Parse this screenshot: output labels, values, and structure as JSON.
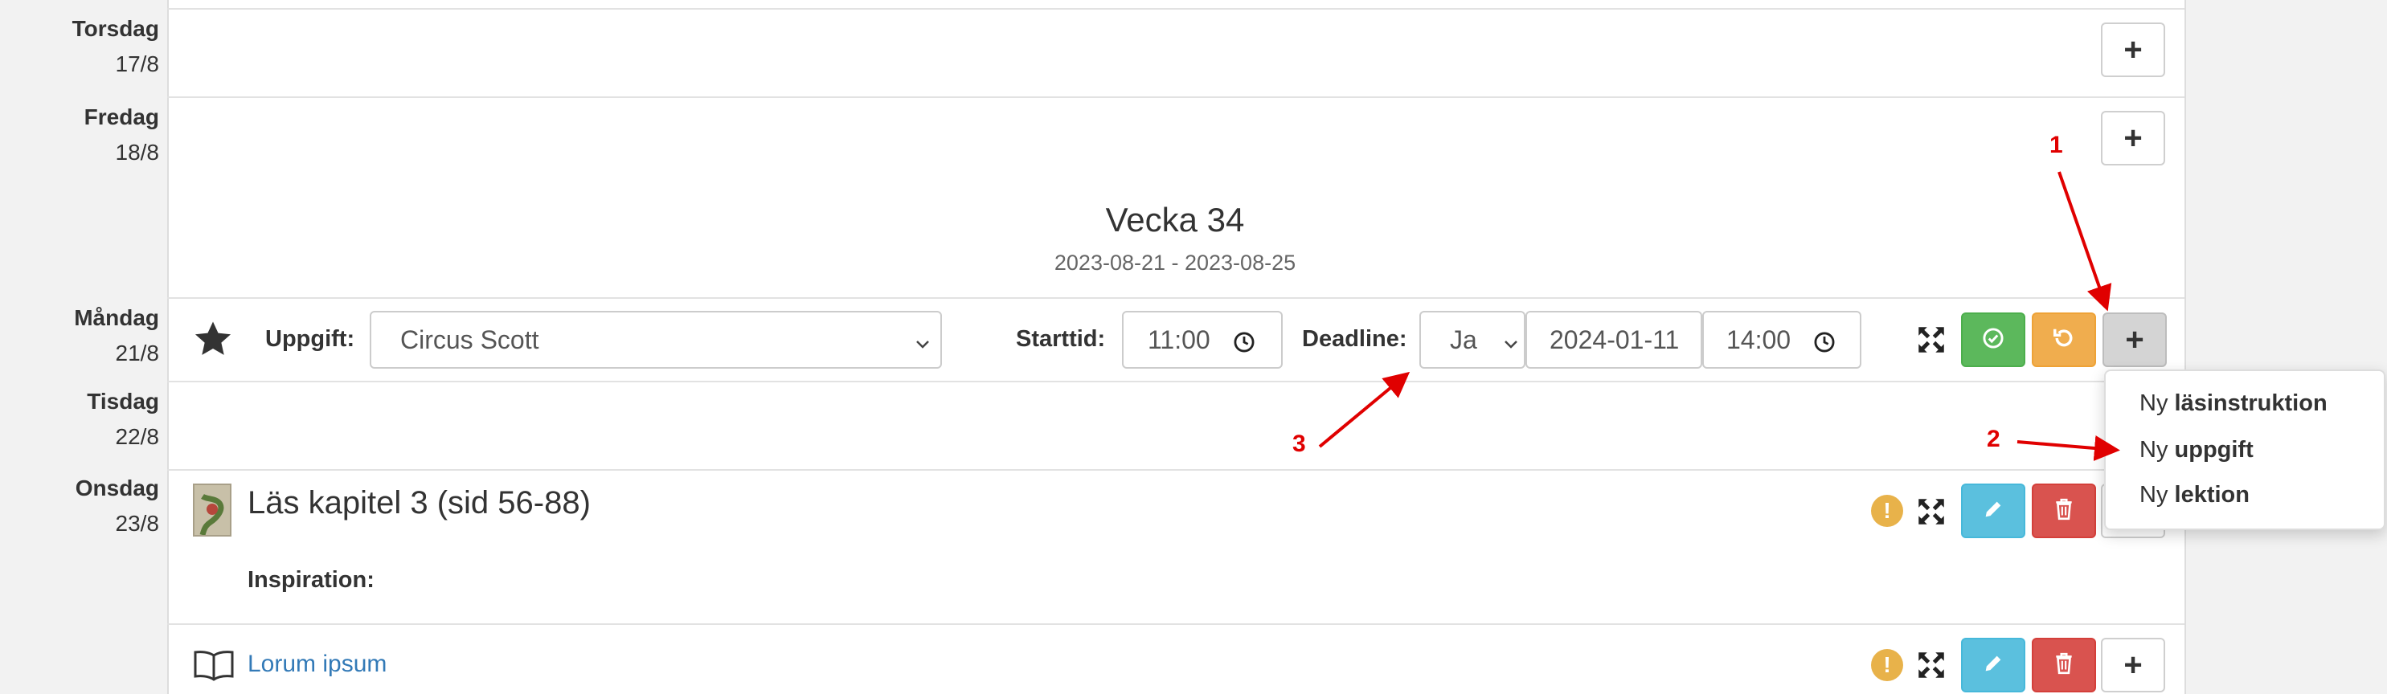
{
  "days": [
    {
      "name": "Torsdag",
      "date": "17/8"
    },
    {
      "name": "Fredag",
      "date": "18/8"
    },
    {
      "name": "Måndag",
      "date": "21/8"
    },
    {
      "name": "Tisdag",
      "date": "22/8"
    },
    {
      "name": "Onsdag",
      "date": "23/8"
    }
  ],
  "week": {
    "title": "Vecka 34",
    "range": "2023-08-21 - 2023-08-25"
  },
  "form": {
    "task_label": "Uppgift:",
    "task_value": "Circus Scott",
    "start_label": "Starttid:",
    "start_time": "11:00",
    "deadline_label": "Deadline:",
    "deadline_choice": "Ja",
    "deadline_date": "2024-01-11",
    "deadline_time": "14:00"
  },
  "menu": {
    "items": [
      {
        "prefix": "Ny",
        "bold": "läsinstruktion"
      },
      {
        "prefix": "Ny",
        "bold": "uppgift"
      },
      {
        "prefix": "Ny",
        "bold": "lektion"
      }
    ]
  },
  "entries": {
    "reading_title": "Läs kapitel 3 (sid 56-88)",
    "inspiration_label": "Inspiration:",
    "link_text": "Lorum ipsum"
  },
  "annotations": {
    "n1": "1",
    "n2": "2",
    "n3": "3"
  },
  "glyphs": {
    "plus": "+",
    "warn": "!"
  },
  "colors": {
    "green": "#5cb85c",
    "orange": "#f0ad4e",
    "blue": "#5bc0de",
    "red": "#d9534f",
    "annotation": "#e00000",
    "link": "#337ab7"
  }
}
